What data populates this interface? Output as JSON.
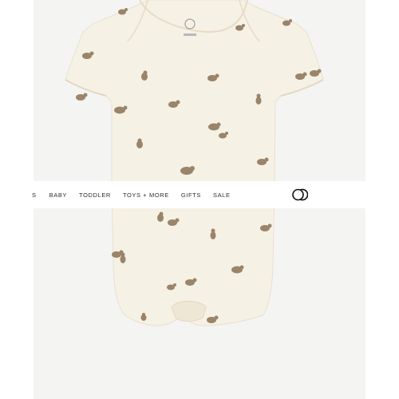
{
  "nav": {
    "items": [
      {
        "label": "S"
      },
      {
        "label": "BABY"
      },
      {
        "label": "TODDLER"
      },
      {
        "label": "TOYS + MORE"
      },
      {
        "label": "GIFTS"
      },
      {
        "label": "SALE"
      }
    ]
  },
  "brand": {
    "logo_icon": "colored-organics-logo-icon"
  },
  "product": {
    "image": "short-sleeve-bodysuit-bear-print",
    "fabric_color": "#f6f1e5",
    "print_color": "#9a846a"
  }
}
